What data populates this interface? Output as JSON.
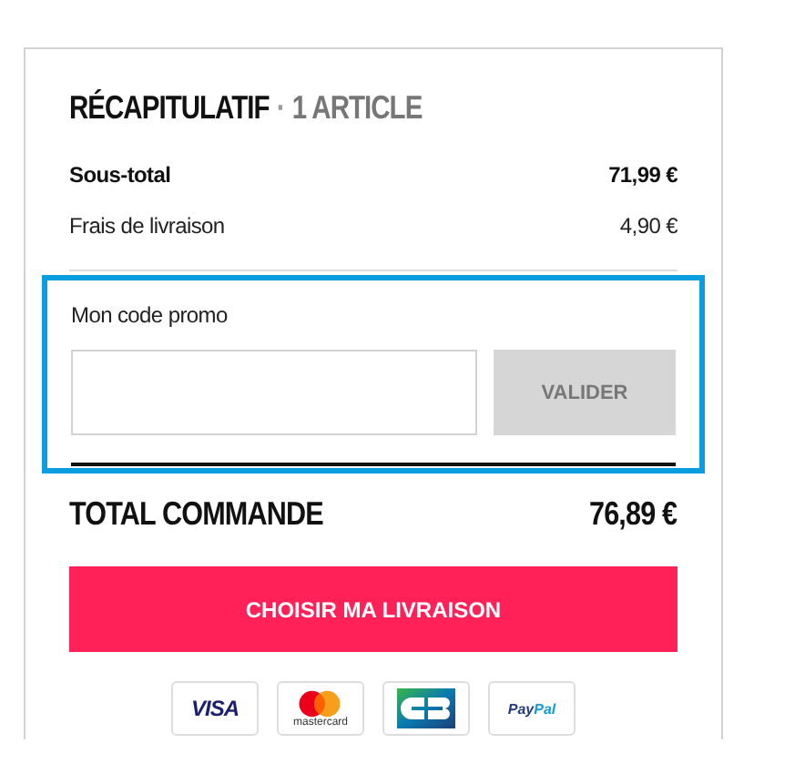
{
  "summary": {
    "title": "RÉCAPITULATIF",
    "separator": "·",
    "count": "1 ARTICLE"
  },
  "lines": [
    {
      "label": "Sous-total",
      "value": "71,99 €",
      "kind": "bold"
    },
    {
      "label": "Frais de livraison",
      "value": "4,90 €",
      "kind": "normal"
    }
  ],
  "promo": {
    "label": "Mon code promo",
    "button": "VALIDER",
    "focused": true
  },
  "total": {
    "label": "TOTAL COMMANDE",
    "value": "76,89 €"
  },
  "checkout_button": "CHOISIR MA LIVRAISON",
  "payment_methods": [
    {
      "kind": "visa",
      "label": "VISA"
    },
    {
      "kind": "mastercard",
      "label": "mastercard"
    },
    {
      "kind": "cb"
    },
    {
      "kind": "paypal",
      "label": "Pay",
      "label_2": "Pal"
    }
  ]
}
